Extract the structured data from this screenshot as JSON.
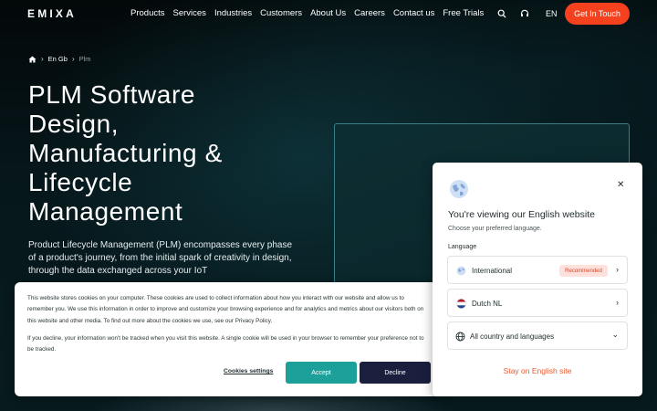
{
  "nav": {
    "logo": "EMIXA",
    "menu": [
      "Products",
      "Services",
      "Industries",
      "Customers",
      "About Us",
      "Careers",
      "Contact us",
      "Free Trials"
    ],
    "search_icon": "search-icon",
    "support_icon": "headset-icon",
    "language": "EN",
    "cta_label": "Get In Touch"
  },
  "breadcrumb": {
    "home_icon": "home-icon",
    "items": [
      "En Gb",
      "Plm"
    ]
  },
  "hero": {
    "title_lines": [
      "PLM Software",
      "Design,",
      "Manufacturing &",
      "Lifecycle",
      "Management"
    ],
    "description": "Product Lifecycle Management (PLM) encompasses every phase of a product's journey, from the initial spark of creativity in design, through the data exchanged across your IoT"
  },
  "cookie": {
    "text1": "This website stores cookies on your computer. These cookies are used to collect information about how you interact with our website and allow us to remember you. We use this information in order to improve and customize your browsing experience and for analytics and metrics about our visitors both on this website and other media. To find out more about the cookies we use, see our Privacy Policy.",
    "text2": "If you decline, your information won't be tracked when you visit this website. A single cookie will be used in your browser to remember your preference not to be tracked.",
    "settings_label": "Cookies settings",
    "accept_label": "Accept",
    "decline_label": "Decline",
    "accept_color": "#1ea09a",
    "decline_color": "#1a1f3d"
  },
  "language_modal": {
    "title": "You're viewing our English website",
    "subtitle": "Choose your preferred language.",
    "language_label": "Language",
    "options": [
      {
        "label": "International",
        "badge": "Recommended",
        "icon": "globe-icon"
      },
      {
        "label": "Dutch NL",
        "icon": "netherlands-flag-icon"
      },
      {
        "label": "All country and languages",
        "icon": "world-icon"
      }
    ],
    "stay_label": "Stay on English site",
    "accent_color": "#e85a30"
  },
  "colors": {
    "cta": "#f5411e",
    "background": "#050d10"
  }
}
